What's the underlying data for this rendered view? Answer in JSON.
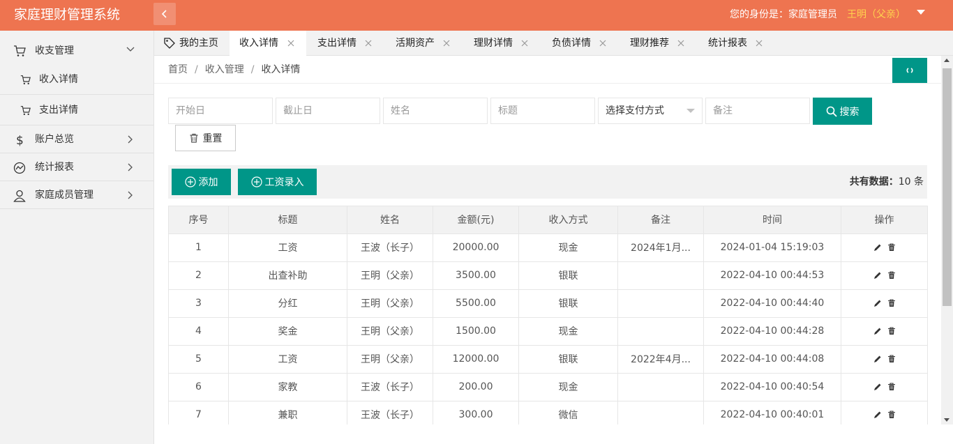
{
  "header": {
    "app_title": "家庭理财管理系统",
    "identity_text": "您的身份是：家庭管理员",
    "user_name": "王明（父亲）"
  },
  "sidebar": {
    "groups": [
      {
        "label": "收支管理",
        "icon": "cart-icon",
        "expanded": true,
        "children": [
          {
            "label": "收入详情"
          },
          {
            "label": "支出详情"
          }
        ]
      },
      {
        "label": "账户总览",
        "icon": "dollar-icon"
      },
      {
        "label": "统计报表",
        "icon": "chart-line-icon"
      },
      {
        "label": "家庭成员管理",
        "icon": "user-icon"
      }
    ]
  },
  "tabs": [
    {
      "label": "我的主页",
      "closable": false
    },
    {
      "label": "收入详情",
      "closable": true,
      "active": true
    },
    {
      "label": "支出详情",
      "closable": true
    },
    {
      "label": "活期资产",
      "closable": true
    },
    {
      "label": "理财详情",
      "closable": true
    },
    {
      "label": "负债详情",
      "closable": true
    },
    {
      "label": "理财推荐",
      "closable": true
    },
    {
      "label": "统计报表",
      "closable": true
    }
  ],
  "breadcrumb": {
    "home": "首页",
    "level2": "收入管理",
    "current": "收入详情"
  },
  "filters": {
    "start_date_placeholder": "开始日",
    "end_date_placeholder": "截止日",
    "name_placeholder": "姓名",
    "title_placeholder": "标题",
    "payment_select": "选择支付方式",
    "remark_placeholder": "备注",
    "search_label": "搜索",
    "reset_label": "重置"
  },
  "toolbar": {
    "add_label": "添加",
    "salary_label": "工资录入",
    "total_label": "共有数据：",
    "total_count": "10",
    "total_unit": "条"
  },
  "table": {
    "columns": [
      "序号",
      "标题",
      "姓名",
      "金额(元)",
      "收入方式",
      "备注",
      "时间",
      "操作"
    ],
    "rows": [
      [
        "1",
        "工资",
        "王波（长子）",
        "20000.00",
        "现金",
        "2024年1月...",
        "2024-01-04 15:19:03"
      ],
      [
        "2",
        "出查补助",
        "王明（父亲）",
        "3500.00",
        "银联",
        "",
        "2022-04-10 00:44:53"
      ],
      [
        "3",
        "分红",
        "王明（父亲）",
        "5500.00",
        "银联",
        "",
        "2022-04-10 00:44:40"
      ],
      [
        "4",
        "奖金",
        "王明（父亲）",
        "1500.00",
        "现金",
        "",
        "2022-04-10 00:44:28"
      ],
      [
        "5",
        "工资",
        "王明（父亲）",
        "12000.00",
        "银联",
        "2022年4月...",
        "2022-04-10 00:44:08"
      ],
      [
        "6",
        "家教",
        "王波（长子）",
        "200.00",
        "现金",
        "",
        "2022-04-10 00:40:54"
      ],
      [
        "7",
        "兼职",
        "王波（长子）",
        "300.00",
        "微信",
        "",
        "2022-04-10 00:40:01"
      ]
    ]
  },
  "colors": {
    "header_bg": "#ee7450",
    "accent": "#009688",
    "user_name": "#ffd24d"
  }
}
